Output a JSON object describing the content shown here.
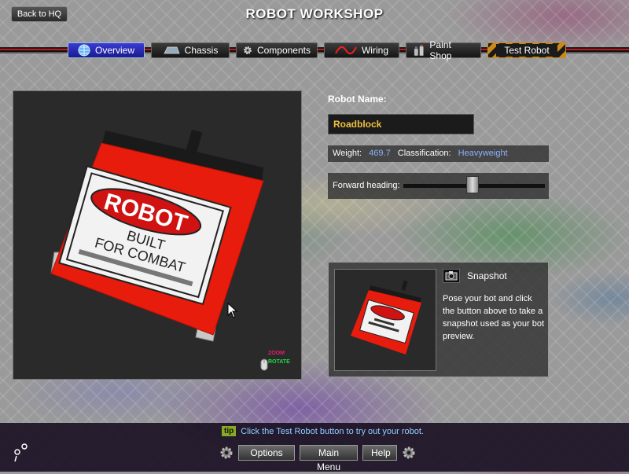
{
  "header": {
    "back_label": "Back to HQ",
    "title": "ROBOT WORKSHOP"
  },
  "tabs": [
    {
      "label": "Overview",
      "icon": "globe-icon",
      "active": true
    },
    {
      "label": "Chassis",
      "icon": "chassis-icon",
      "active": false
    },
    {
      "label": "Components",
      "icon": "gear-icon",
      "active": false
    },
    {
      "label": "Wiring",
      "icon": "wire-icon",
      "active": false
    },
    {
      "label": "Paint Shop",
      "icon": "paint-icon",
      "active": false
    },
    {
      "label": "Test Robot",
      "icon": "",
      "active": false
    }
  ],
  "viewport": {
    "sign_text_1": "ROBOT",
    "sign_text_2": "BUILT",
    "sign_text_3": "FOR COMBAT",
    "zoom_label": "ZOOM",
    "rotate_label": "ROTATE"
  },
  "robot": {
    "name_label": "Robot Name:",
    "name_value": "Roadblock",
    "weight_label": "Weight:",
    "weight_value": "469.7",
    "class_label": "Classification:",
    "class_value": "Heavyweight",
    "heading_label": "Forward heading:",
    "heading_fraction": 0.49
  },
  "snapshot": {
    "title": "Snapshot",
    "description": "Pose your bot and click the button above to take a snapshot used as your bot preview."
  },
  "footer": {
    "tip_badge": "tip",
    "tip_text": "Click the Test Robot button to try out your robot.",
    "options_label": "Options",
    "main_menu_label": "Main Menu",
    "help_label": "Help"
  },
  "colors": {
    "accent_blue": "#8db0ff",
    "name_yellow": "#f0c040",
    "robot_red": "#e81c0c"
  }
}
